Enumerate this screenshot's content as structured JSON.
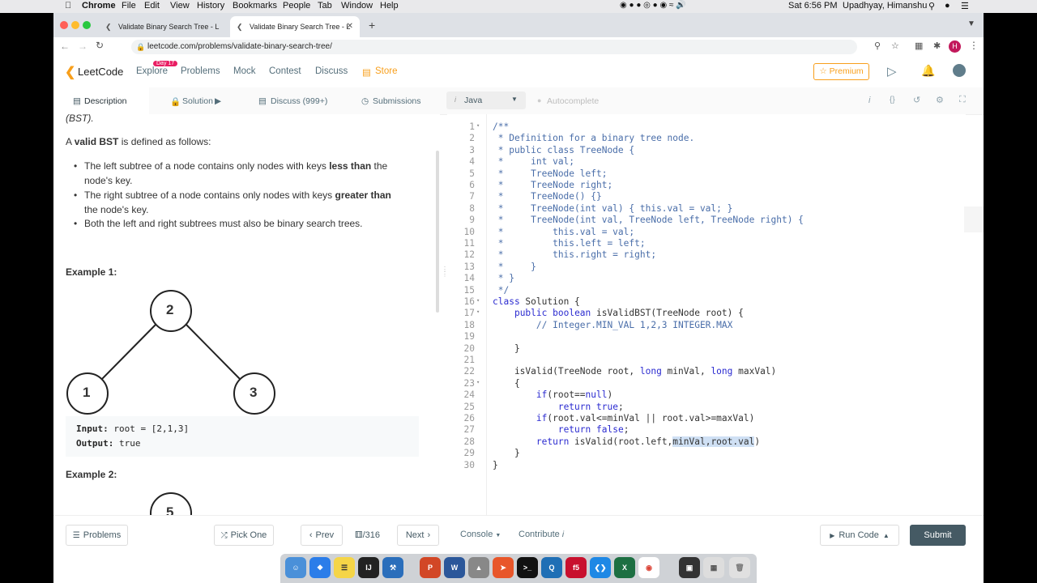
{
  "menubar": {
    "app": "Chrome",
    "items": [
      "File",
      "Edit",
      "View",
      "History",
      "Bookmarks",
      "People",
      "Tab",
      "Window",
      "Help"
    ],
    "clock": "Sat 6:56 PM",
    "user": "Upadhyay, Himanshu"
  },
  "browser": {
    "tabs": [
      {
        "title": "Validate Binary Search Tree - L"
      },
      {
        "title": "Validate Binary Search Tree - L"
      }
    ],
    "new_tab": "+",
    "url": "leetcode.com/problems/validate-binary-search-tree/",
    "profile_initial": "H"
  },
  "nav": {
    "logo": "LeetCode",
    "badge": "Day 17",
    "links": [
      "Explore",
      "Problems",
      "Mock",
      "Contest",
      "Discuss",
      "Store"
    ],
    "premium": "Premium"
  },
  "desc_tabs": [
    "Description",
    "Solution",
    "Discuss (999+)",
    "Submissions"
  ],
  "editor_tools": {
    "language": "Java",
    "autocomplete": "Autocomplete"
  },
  "description": {
    "top_fragment": "(BST).",
    "intro_prefix": "A ",
    "intro_bold": "valid BST",
    "intro_suffix": " is defined as follows:",
    "bullets": [
      {
        "a": "The left subtree of a node contains only nodes with keys ",
        "b": "less than",
        "c": " the",
        "d": "node's key."
      },
      {
        "a": "The right subtree of a node contains only nodes with keys ",
        "b": "greater than",
        "c": "",
        "d": "the node's key."
      },
      {
        "a": "Both the left and right subtrees must also be binary search trees.",
        "b": "",
        "c": "",
        "d": ""
      }
    ],
    "example1_title": "Example 1:",
    "tree1": [
      "2",
      "1",
      "3"
    ],
    "example1_input_label": "Input:",
    "example1_input": "root = [2,1,3]",
    "example1_output_label": "Output:",
    "example1_output": "true",
    "example2_title": "Example 2:",
    "tree2_root": "5"
  },
  "code_lines": [
    "/**",
    " * Definition for a binary tree node.",
    " * public class TreeNode {",
    " *     int val;",
    " *     TreeNode left;",
    " *     TreeNode right;",
    " *     TreeNode() {}",
    " *     TreeNode(int val) { this.val = val; }",
    " *     TreeNode(int val, TreeNode left, TreeNode right) {",
    " *         this.val = val;",
    " *         this.left = left;",
    " *         this.right = right;",
    " *     }",
    " * }",
    " */",
    "class Solution {",
    "    public boolean isValidBST(TreeNode root) {",
    "        // Integer.MIN_VAL 1,2,3 INTEGER.MAX",
    "",
    "    }",
    "",
    "    isValid(TreeNode root, long minVal, long maxVal)",
    "    {",
    "        if(root==null)",
    "            return true;",
    "        if(root.val<=minVal || root.val>=maxVal)",
    "            return false;",
    "        return isValid(root.left,minVal,root.val)",
    "    }",
    "}"
  ],
  "bottom": {
    "problems": "Problems",
    "pick_one": "Pick One",
    "prev": "Prev",
    "counter": "/316",
    "next": "Next",
    "console": "Console",
    "contribute": "Contribute",
    "run": "Run Code",
    "submit": "Submit"
  },
  "colors": {
    "accent": "#f89f1b",
    "submit": "#455a64",
    "badge": "#e91e63"
  }
}
